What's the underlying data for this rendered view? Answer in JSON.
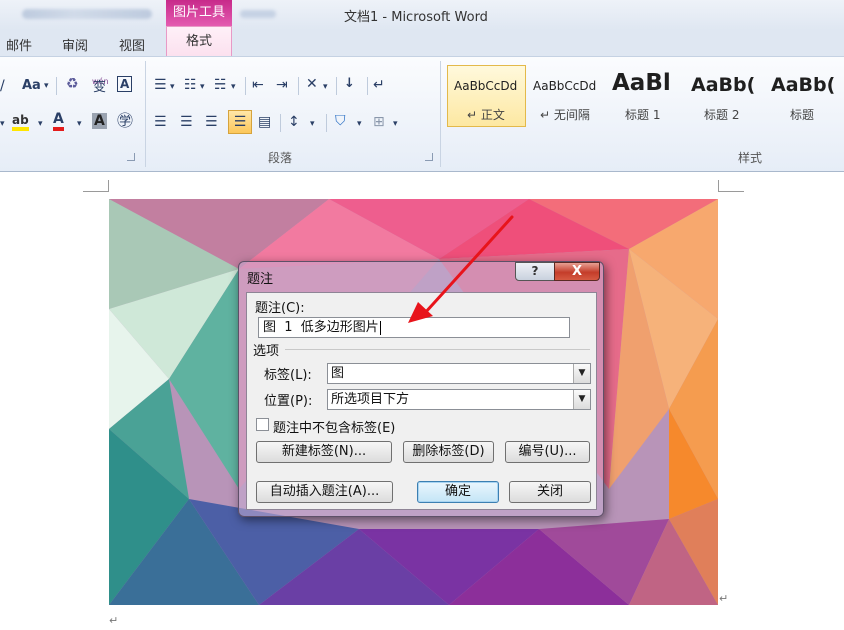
{
  "titlebar": {
    "context_tab": "图片工具",
    "title": "文档1 - Microsoft Word"
  },
  "tabs": {
    "mail": "邮件",
    "review": "审阅",
    "view": "视图",
    "format": "格式"
  },
  "ribbon": {
    "paragraph_group": "段落",
    "styles_group": "样式",
    "font_buttons": {
      "case": "Aa",
      "phonetic": "wén"
    },
    "styles": [
      {
        "preview": "AaBbCcDd",
        "name": "↵ 正文"
      },
      {
        "preview": "AaBbCcDd",
        "name": "↵ 无间隔"
      },
      {
        "preview": "AaBl",
        "name": "标题 1"
      },
      {
        "preview": "AaBb(",
        "name": "标题 2"
      },
      {
        "preview": "AaBb(",
        "name": "标题"
      }
    ]
  },
  "document": {
    "para_mark": "↵"
  },
  "dialog": {
    "title": "题注",
    "help_label": "?",
    "close_label": "X",
    "caption_label": "题注(C):",
    "caption_value": "图  1  低多边形图片",
    "options_label": "选项",
    "label_label": "标签(L):",
    "label_value": "图",
    "position_label": "位置(P):",
    "position_value": "所选项目下方",
    "exclude_label": "题注中不包含标签(E)",
    "exclude_checked": false,
    "new_label_button": "新建标签(N)...",
    "delete_label_button": "删除标签(D)",
    "numbering_button": "编号(U)...",
    "autocaption_button": "自动插入题注(A)...",
    "ok_button": "确定",
    "close_button": "关闭"
  },
  "colors": {
    "context_tab": "#d23e97",
    "arrow": "#e8141b"
  }
}
